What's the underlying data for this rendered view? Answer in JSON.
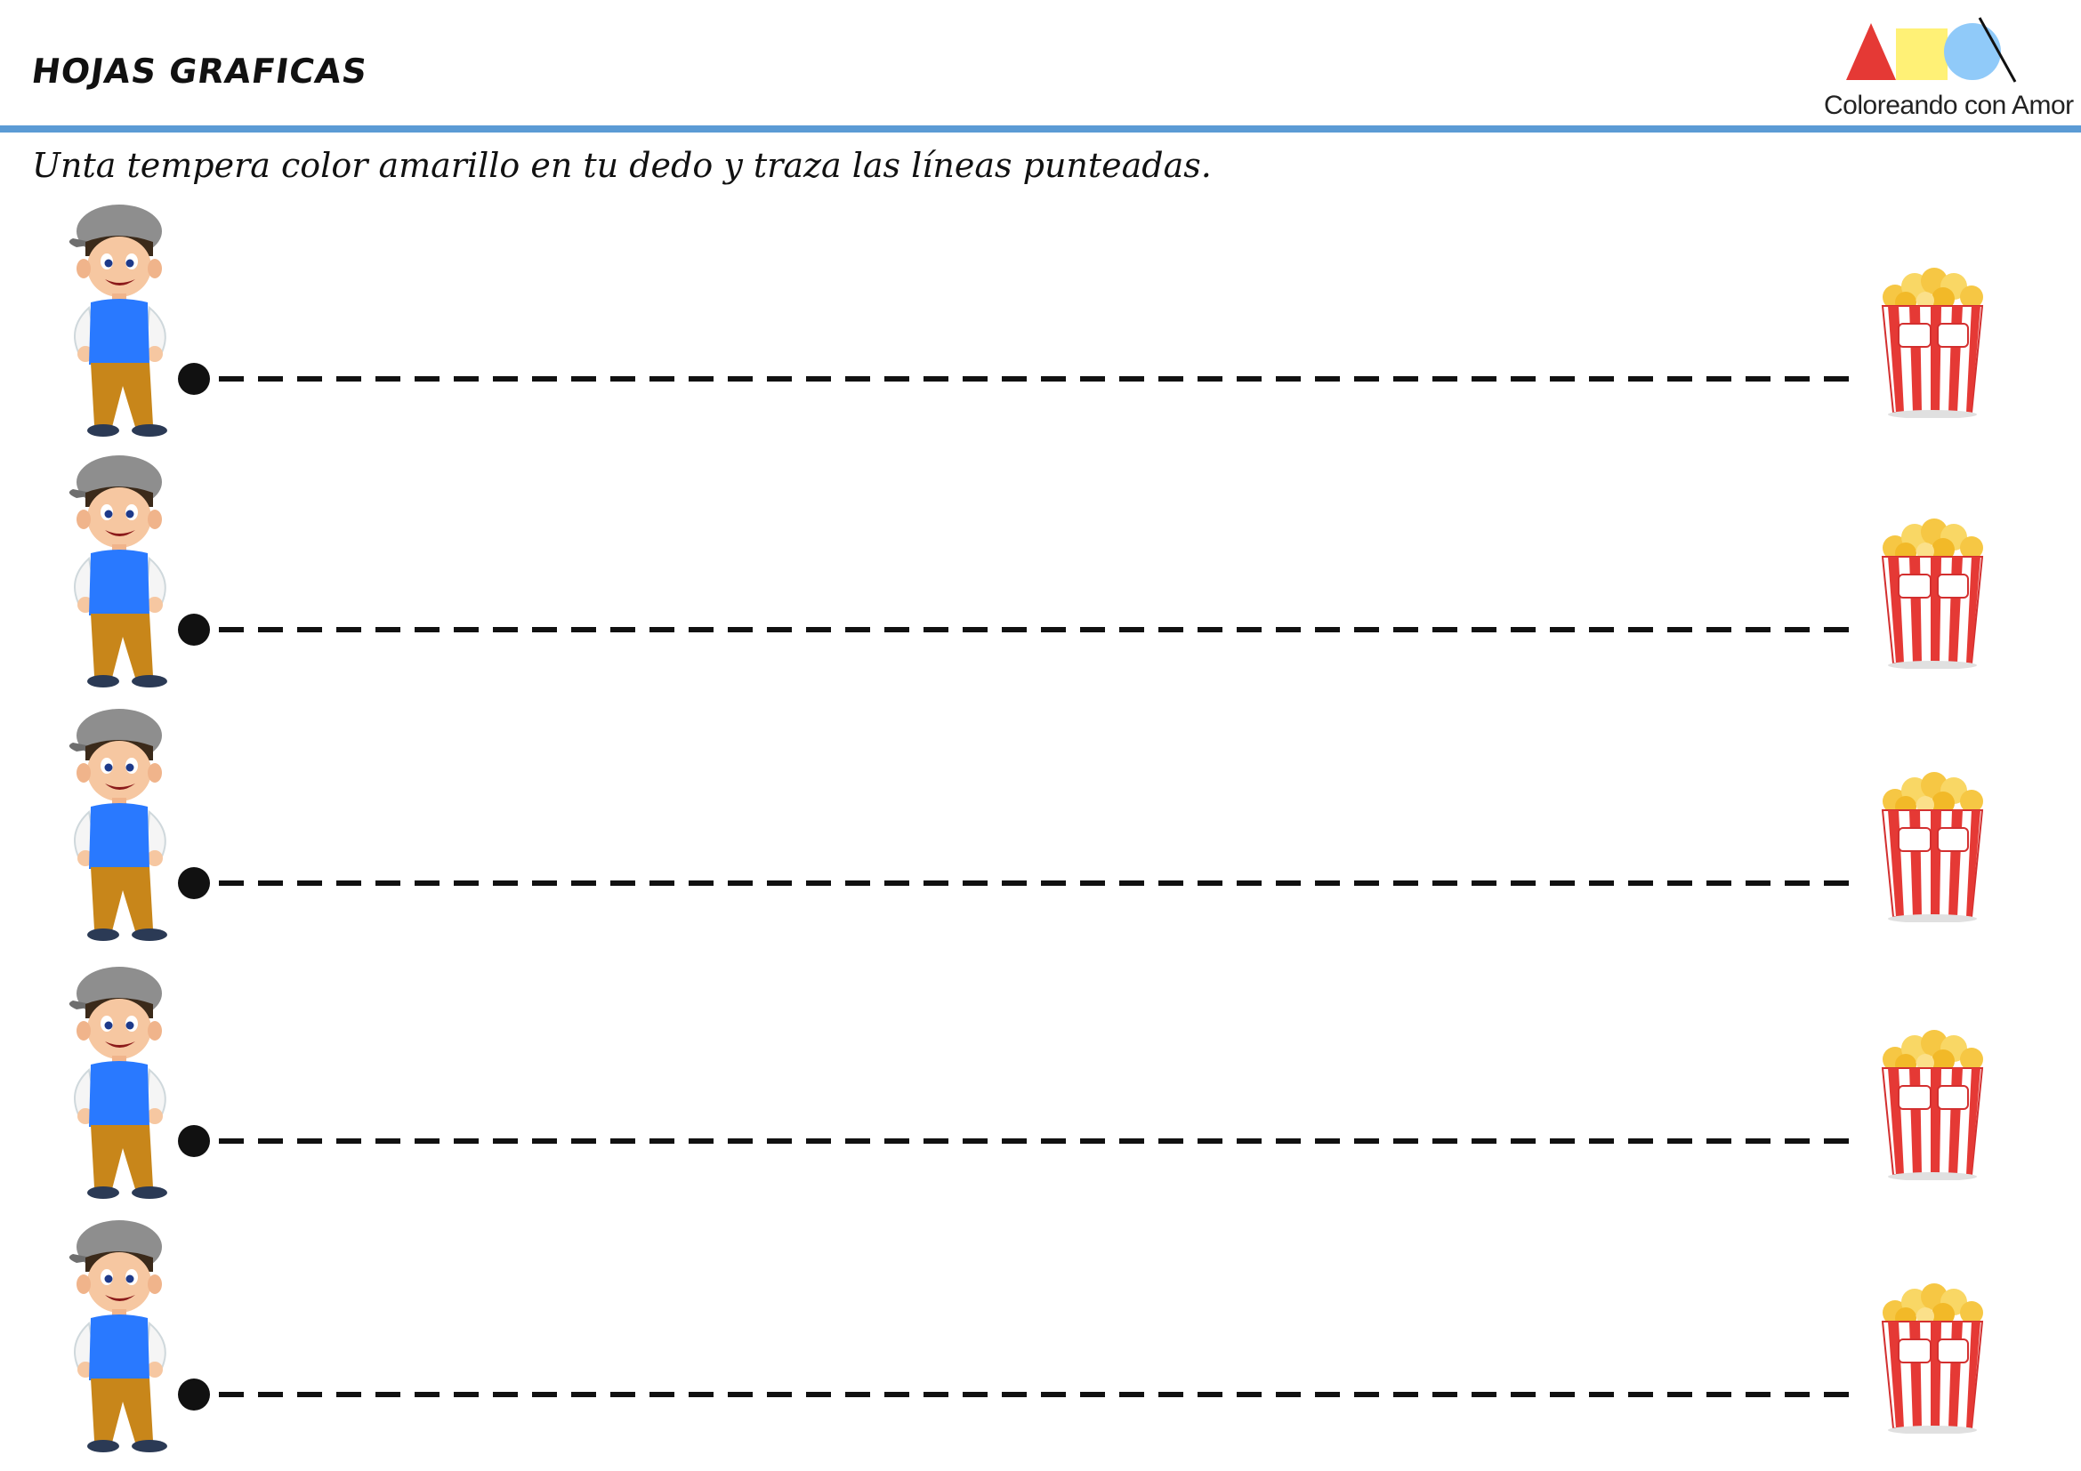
{
  "header": {
    "title": "HOJAS GRAFICAS"
  },
  "logo": {
    "text": "Coloreando con Amor",
    "colors": {
      "triangle": "#e53935",
      "square": "#fff176",
      "circle": "#90caf9"
    }
  },
  "instruction": "Unta tempera color amarillo en tu dedo y traza las líneas punteadas.",
  "rows": [
    {
      "start_icon": "boy-icon",
      "end_icon": "popcorn-icon"
    },
    {
      "start_icon": "boy-icon",
      "end_icon": "popcorn-icon"
    },
    {
      "start_icon": "boy-icon",
      "end_icon": "popcorn-icon"
    },
    {
      "start_icon": "boy-icon",
      "end_icon": "popcorn-icon"
    },
    {
      "start_icon": "boy-icon",
      "end_icon": "popcorn-icon"
    }
  ],
  "colors": {
    "rule": "#5b9bd5",
    "line": "#111111",
    "shirt": "#2979ff",
    "pants": "#c8861a",
    "cap": "#8e8e8e",
    "popcorn_red": "#e53935",
    "popcorn_kernel": "#f6c744"
  }
}
